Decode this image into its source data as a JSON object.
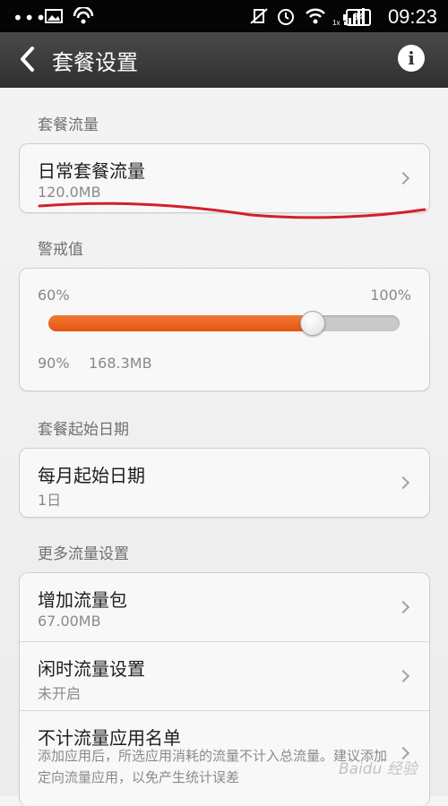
{
  "status_bar": {
    "time": "09:23",
    "battery": "84",
    "icons": [
      "more-dots-icon",
      "image-notification-icon",
      "sync-icon",
      "vibrate-off-icon",
      "alarm-icon",
      "wifi-icon",
      "signal-icon",
      "battery-icon"
    ]
  },
  "app_bar": {
    "title": "套餐设置",
    "back_icon": "chevron-left-icon",
    "info_icon": "info-icon"
  },
  "sections": {
    "plan": {
      "header": "套餐流量",
      "item": {
        "label": "日常套餐流量",
        "value": "120.0MB"
      }
    },
    "warning": {
      "header": "警戒值",
      "min_label": "60%",
      "max_label": "100%",
      "current_percent": "90%",
      "current_amount": "168.3MB",
      "slider_fraction": 0.75
    },
    "start_date": {
      "header": "套餐起始日期",
      "item": {
        "label": "每月起始日期",
        "value": "1日"
      }
    },
    "more": {
      "header": "更多流量设置",
      "items": [
        {
          "label": "增加流量包",
          "value": "67.00MB"
        },
        {
          "label": "闲时流量设置",
          "value": "未开启"
        },
        {
          "label": "不计流量应用名单",
          "value": "添加应用后，所选应用消耗的流量不计入总流量。建议添加定向流量应用，以免产生统计误差"
        }
      ]
    }
  },
  "watermark": "Baidu 经验",
  "colors": {
    "accent": "#e8601f",
    "annotation": "#d3202a",
    "app_bar": "#3a3a3a",
    "status_bar": "#050505"
  }
}
